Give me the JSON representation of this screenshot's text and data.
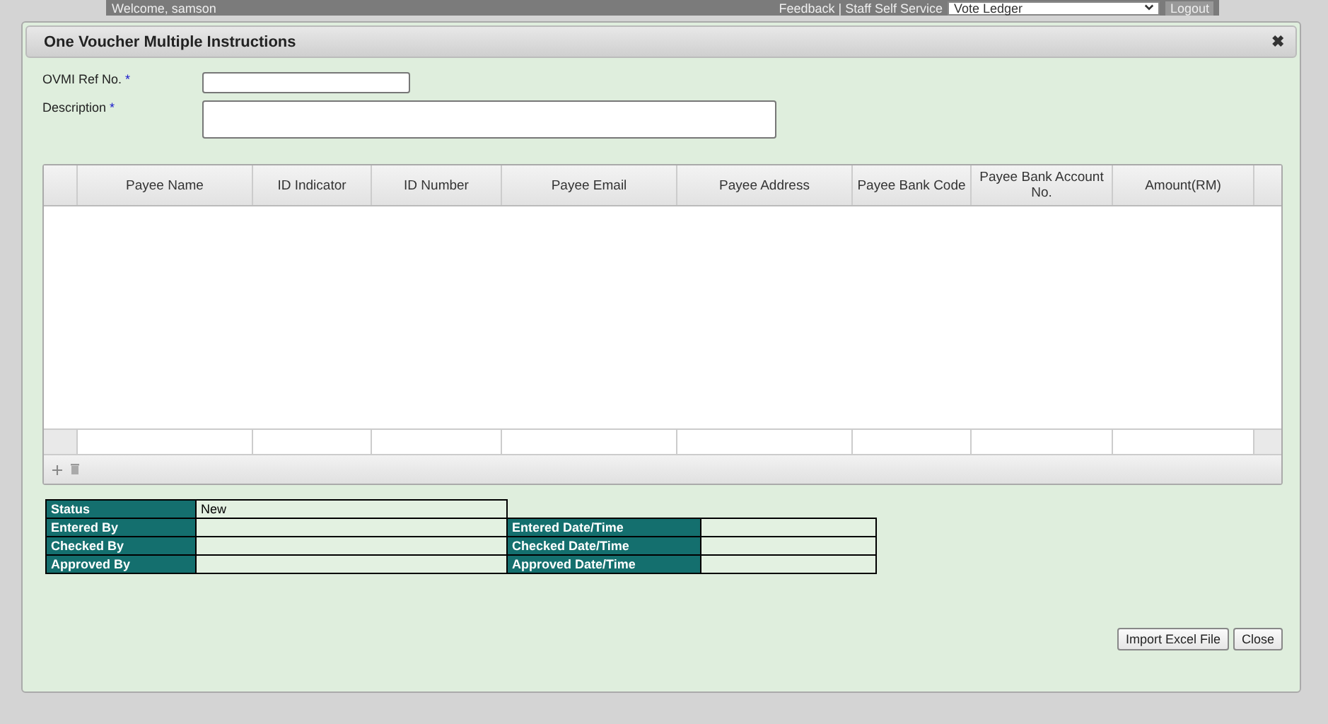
{
  "top_bar": {
    "welcome": "Welcome, samson",
    "links": "Feedback | Staff Self Service",
    "ledger_select": "Vote Ledger",
    "logout": "Logout"
  },
  "dialog": {
    "title": "One Voucher Multiple Instructions",
    "close": "✖"
  },
  "fields": [
    {
      "label": "OVMI Ref No.",
      "required_mark": "*",
      "kind": "short"
    },
    {
      "label": "Description",
      "required_mark": "*",
      "kind": "wide"
    }
  ],
  "table": {
    "columns": [
      "Payee Name",
      "ID Indicator",
      "ID Number",
      "Payee Email",
      "Payee Address",
      "Payee Bank Code",
      "Payee Bank Account No.",
      "Amount(RM)"
    ]
  },
  "status": {
    "rows": [
      {
        "label": "Status",
        "value": "New"
      },
      {
        "label": "Entered By",
        "date_label": "Entered Date/Time"
      },
      {
        "label": "Checked By",
        "date_label": "Checked Date/Time"
      },
      {
        "label": "Approved By",
        "date_label": "Approved Date/Time"
      }
    ]
  },
  "buttons": [
    "Import Excel File",
    "Close"
  ]
}
